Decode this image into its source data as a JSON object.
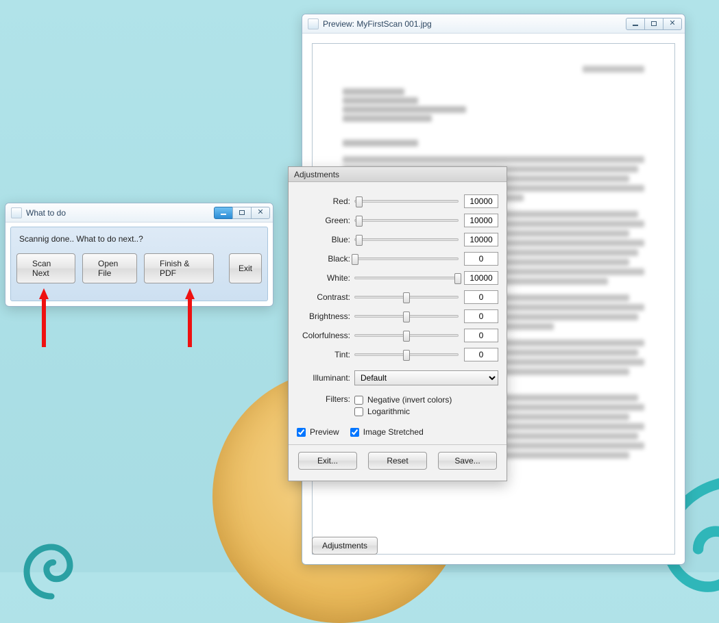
{
  "preview": {
    "title": "Preview: MyFirstScan 001.jpg",
    "adjustments_btn": "Adjustments"
  },
  "wtd": {
    "title": "What to do",
    "message": "Scannig done.. What to do next..?",
    "scan_next": "Scan Next",
    "open_file": "Open File",
    "finish_pdf": "Finish & PDF",
    "exit": "Exit"
  },
  "adj": {
    "title": "Adjustments",
    "sliders": {
      "red": {
        "label": "Red:",
        "value": "10000",
        "pos": 4
      },
      "green": {
        "label": "Green:",
        "value": "10000",
        "pos": 4
      },
      "blue": {
        "label": "Blue:",
        "value": "10000",
        "pos": 4
      },
      "black": {
        "label": "Black:",
        "value": "0",
        "pos": 0
      },
      "white": {
        "label": "White:",
        "value": "10000",
        "pos": 100
      },
      "contrast": {
        "label": "Contrast:",
        "value": "0",
        "pos": 50
      },
      "brightness": {
        "label": "Brightness:",
        "value": "0",
        "pos": 50
      },
      "colorfulness": {
        "label": "Colorfulness:",
        "value": "0",
        "pos": 50
      },
      "tint": {
        "label": "Tint:",
        "value": "0",
        "pos": 50
      }
    },
    "illuminant_label": "Illuminant:",
    "illuminant_value": "Default",
    "filters_label": "Filters:",
    "negative_label": "Negative (invert colors)",
    "logarithmic_label": "Logarithmic",
    "preview_label": "Preview",
    "stretched_label": "Image Stretched",
    "exit_btn": "Exit...",
    "reset_btn": "Reset",
    "save_btn": "Save..."
  }
}
